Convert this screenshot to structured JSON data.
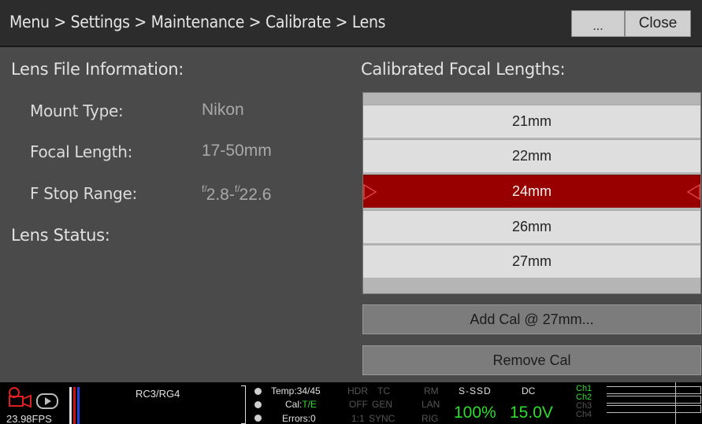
{
  "header": {
    "breadcrumb": "Menu > Settings > Maintenance > Calibrate > Lens",
    "more_label": "...",
    "close_label": "Close"
  },
  "lens_info": {
    "title": "Lens File Information:",
    "mount_label": "Mount Type:",
    "mount_value": "Nikon",
    "focal_label": "Focal Length:",
    "focal_value": "17-50mm",
    "fstop_label": "F Stop Range:",
    "fstop_frac": "f/",
    "fstop_min": "2.8-",
    "fstop_max": "22.6",
    "status_title": "Lens Status:"
  },
  "calibrated": {
    "title": "Calibrated Focal Lengths:",
    "items": [
      "21mm",
      "22mm",
      "24mm",
      "26mm",
      "27mm"
    ],
    "selected_index": 2,
    "add_label": "Add Cal @ 27mm...",
    "remove_label": "Remove Cal"
  },
  "statusbar": {
    "fps": "23.98FPS",
    "looks": "RC3/RG4",
    "temp": "Temp:34/45",
    "cal_prefix": "Cal:",
    "cal_value": "T/E",
    "errors": "Errors:0",
    "hdr": "HDR",
    "hdr_val": "OFF",
    "hdr_ratio": "1:1",
    "tc": "TC",
    "tc_val": "GEN",
    "tc_sync": "SYNC",
    "rm": "RM",
    "rm_val": "LAN",
    "rm_rig": "RIG",
    "media": "S-SSD",
    "media_val": "100%",
    "power": "DC",
    "power_val": "15.0V",
    "ch1": "Ch1",
    "ch2": "Ch2",
    "ch3": "Ch3",
    "ch4": "Ch4",
    "accent_green": "#2edb2e",
    "accent_red": "#980000"
  }
}
